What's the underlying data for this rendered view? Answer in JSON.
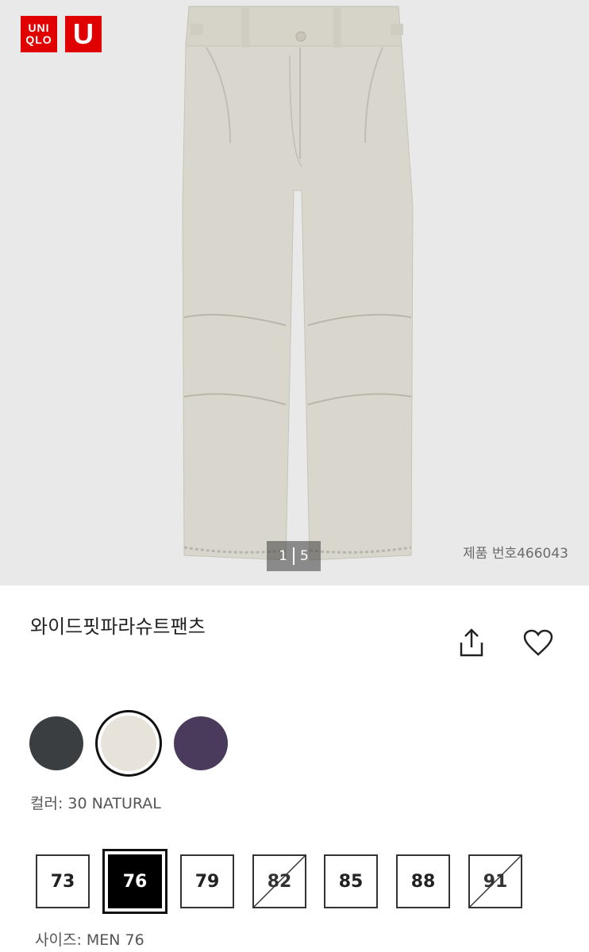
{
  "brand": {
    "logo_line1": "UNI",
    "logo_line2": "QLO",
    "sub_logo": "U",
    "color": "#e00000"
  },
  "gallery": {
    "current": "1",
    "total": "5",
    "product_number": "제품 번호466043"
  },
  "product": {
    "title": "와이드핏파라슈트팬츠"
  },
  "actions": {
    "share_icon": "share-icon",
    "favorite_icon": "heart-icon"
  },
  "colors": {
    "swatches": [
      {
        "name": "dark-gray",
        "hex": "#3b3e40"
      },
      {
        "name": "natural",
        "hex": "#e7e3da",
        "selected": true
      },
      {
        "name": "purple",
        "hex": "#4a3b5d"
      }
    ],
    "label": "컬러: 30 NATURAL"
  },
  "sizes": {
    "options": [
      {
        "label": "73",
        "available": true
      },
      {
        "label": "76",
        "available": true,
        "selected": true
      },
      {
        "label": "79",
        "available": true
      },
      {
        "label": "82",
        "available": false
      },
      {
        "label": "85",
        "available": true
      },
      {
        "label": "88",
        "available": true
      },
      {
        "label": "91",
        "available": false
      }
    ],
    "label": "사이즈: MEN 76"
  }
}
